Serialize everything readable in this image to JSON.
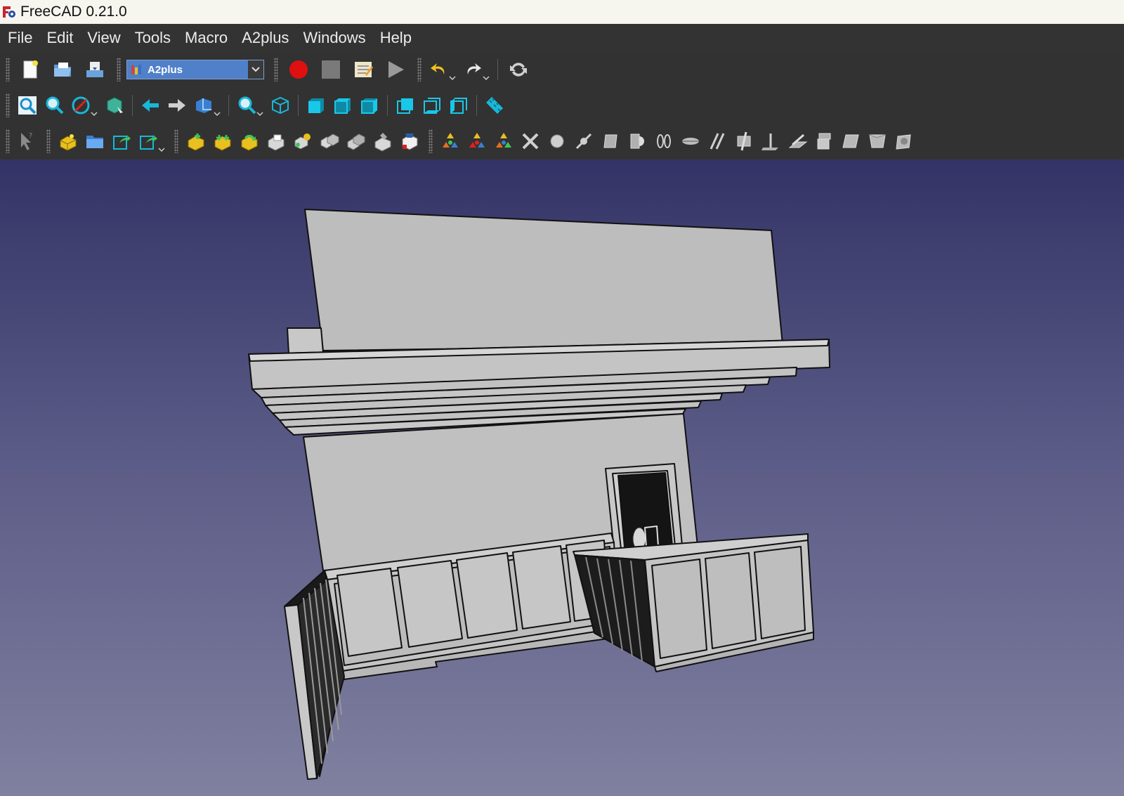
{
  "window": {
    "title": "FreeCAD 0.21.0"
  },
  "menu": [
    "File",
    "Edit",
    "View",
    "Tools",
    "Macro",
    "A2plus",
    "Windows",
    "Help"
  ],
  "workbench": {
    "selected": "A2plus"
  },
  "colors": {
    "menu_bg": "#333333",
    "toolbar_bg": "#323232",
    "workbench_select": "#4f80c9",
    "viewport_top": "#333366",
    "viewport_bottom": "#8080a0",
    "macro_record": "#e01010",
    "nav_cyan": "#19b7d8",
    "a2plus_yellow": "#e8c020"
  },
  "toolbars": {
    "file": [
      "new-document-icon",
      "open-document-icon",
      "save-document-icon"
    ],
    "macro": [
      "record-macro-icon",
      "stop-macro-icon",
      "edit-macro-icon",
      "execute-macro-icon"
    ],
    "edit": [
      "undo-icon",
      "redo-icon",
      "refresh-icon"
    ],
    "view": [
      "fit-all-icon",
      "fit-selection-icon",
      "draw-style-icon",
      "bounding-box-icon",
      "back-icon",
      "forward-icon",
      "std-views-icon",
      "zoom-icon",
      "isometric-view-icon",
      "front-view-icon",
      "top-view-icon",
      "right-view-icon",
      "rear-view-icon",
      "bottom-view-icon",
      "left-view-icon",
      "measure-icon"
    ],
    "a2plus": [
      "select-icon",
      "add-part-icon",
      "open-folder-icon",
      "export-icon",
      "export-dropdown-icon",
      "import-part-icon",
      "import-shape-icon",
      "update-imports-icon",
      "edit-part-icon",
      "duplicate-part-icon",
      "convert-part-icon",
      "move-part-icon",
      "fixed-part-icon",
      "show-connections-icon",
      "solve-icon",
      "toggle-autosolve-icon",
      "constraint-sub-icon",
      "delete-constraints-icon",
      "point-identity-icon",
      "point-on-line-icon",
      "point-on-plane-icon",
      "sphere-constraint-icon",
      "circular-edge-icon",
      "axis-coincident-icon",
      "axis-parallel-icon",
      "axis-plane-parallel-icon",
      "axis-plane-angle-icon",
      "axis-plane-normal-icon",
      "plane-parallel-icon",
      "planes-coincident-icon",
      "angled-planes-icon",
      "center-of-mass-icon"
    ]
  }
}
